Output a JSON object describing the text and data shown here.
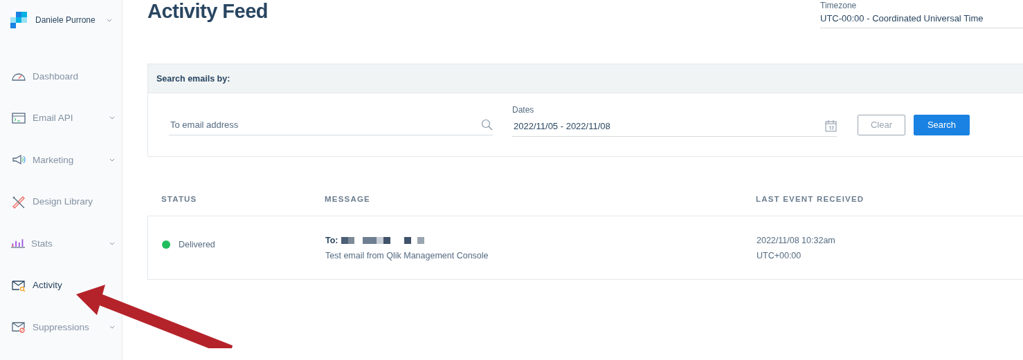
{
  "account": {
    "name": "Daniele Purrone"
  },
  "sidebar": {
    "items": [
      {
        "kind": "dashboard",
        "label": "Dashboard",
        "has_submenu": false,
        "selected": false
      },
      {
        "kind": "email_api",
        "label": "Email API",
        "has_submenu": true,
        "selected": false
      },
      {
        "kind": "marketing",
        "label": "Marketing",
        "has_submenu": true,
        "selected": false
      },
      {
        "kind": "design",
        "label": "Design Library",
        "has_submenu": false,
        "selected": false
      },
      {
        "kind": "stats",
        "label": "Stats",
        "has_submenu": true,
        "selected": false
      },
      {
        "kind": "activity",
        "label": "Activity",
        "has_submenu": false,
        "selected": true
      },
      {
        "kind": "suppressions",
        "label": "Suppressions",
        "has_submenu": true,
        "selected": false
      }
    ]
  },
  "page": {
    "title": "Activity Feed"
  },
  "timezone": {
    "label": "Timezone",
    "value": "UTC-00:00 - Coordinated Universal Time"
  },
  "search": {
    "heading": "Search emails by:",
    "email_placeholder": "To email address",
    "dates_label": "Dates",
    "dates_value": "2022/11/05 - 2022/11/08",
    "buttons": [
      {
        "kind": "secondary",
        "label": "Clear"
      },
      {
        "kind": "primary",
        "label": "Search"
      }
    ]
  },
  "table": {
    "columns": [
      "STATUS",
      "MESSAGE",
      "LAST EVENT RECEIVED"
    ],
    "rows": [
      {
        "status": "Delivered",
        "color": "#1fbd5d",
        "to_label": "To:",
        "subject": "Test email from Qlik Management Console",
        "date": "2022/11/08 10:32am",
        "tz": "UTC+00:00"
      }
    ]
  }
}
